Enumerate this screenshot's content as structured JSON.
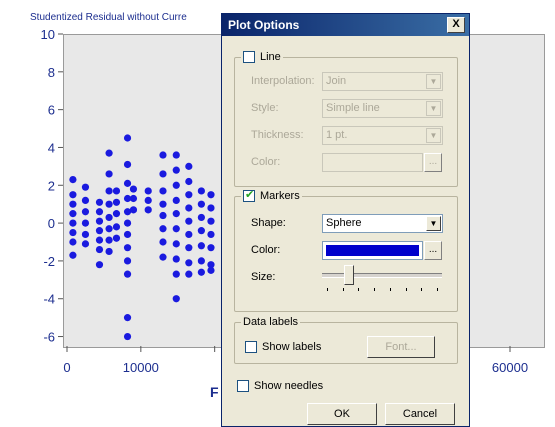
{
  "plot": {
    "title": "Studentized Residual without Curre",
    "x_axis_letter": "F",
    "y_ticks": [
      "10",
      "8",
      "6",
      "4",
      "2",
      "0",
      "-2",
      "-4",
      "-6"
    ],
    "x_ticks": [
      "0",
      "10000",
      "20",
      "60000"
    ],
    "point_color": "#1a1adf"
  },
  "chart_data": {
    "type": "scatter",
    "title": "Studentized Residual without Curre",
    "ylim": [
      -6.5,
      10
    ],
    "xlim": [
      -1000,
      62000
    ],
    "points": [
      [
        800,
        2.3
      ],
      [
        800,
        1.5
      ],
      [
        800,
        1
      ],
      [
        800,
        0.5
      ],
      [
        800,
        0
      ],
      [
        800,
        -0.5
      ],
      [
        800,
        -1
      ],
      [
        800,
        -1.7
      ],
      [
        2500,
        1.9
      ],
      [
        2500,
        1.2
      ],
      [
        2500,
        0.6
      ],
      [
        2500,
        0
      ],
      [
        2500,
        -0.6
      ],
      [
        2500,
        -1.1
      ],
      [
        4400,
        1.1
      ],
      [
        4400,
        0.6
      ],
      [
        4400,
        0.1
      ],
      [
        4400,
        -0.4
      ],
      [
        4400,
        -0.9
      ],
      [
        4400,
        -1.4
      ],
      [
        4400,
        -2.2
      ],
      [
        5700,
        3.7
      ],
      [
        5700,
        2.6
      ],
      [
        5700,
        1.7
      ],
      [
        5700,
        1
      ],
      [
        5700,
        0.3
      ],
      [
        5700,
        -0.3
      ],
      [
        5700,
        -0.9
      ],
      [
        5700,
        -1.5
      ],
      [
        6700,
        1.7
      ],
      [
        6700,
        1.1
      ],
      [
        6700,
        0.5
      ],
      [
        6700,
        -0.2
      ],
      [
        6700,
        -0.8
      ],
      [
        8200,
        4.5
      ],
      [
        8200,
        3.1
      ],
      [
        8200,
        2.1
      ],
      [
        8200,
        1.3
      ],
      [
        8200,
        0.6
      ],
      [
        8200,
        0
      ],
      [
        8200,
        -0.6
      ],
      [
        8200,
        -1.3
      ],
      [
        8200,
        -2
      ],
      [
        8200,
        -2.7
      ],
      [
        8200,
        -5
      ],
      [
        8200,
        -6
      ],
      [
        9000,
        1.8
      ],
      [
        9000,
        1.3
      ],
      [
        9000,
        0.7
      ],
      [
        11000,
        1.7
      ],
      [
        11000,
        1.2
      ],
      [
        11000,
        0.7
      ],
      [
        13000,
        3.6
      ],
      [
        13000,
        2.6
      ],
      [
        13000,
        1.7
      ],
      [
        13000,
        1
      ],
      [
        13000,
        0.4
      ],
      [
        13000,
        -0.3
      ],
      [
        13000,
        -1
      ],
      [
        13000,
        -1.8
      ],
      [
        14800,
        3.6
      ],
      [
        14800,
        2.8
      ],
      [
        14800,
        2
      ],
      [
        14800,
        1.2
      ],
      [
        14800,
        0.5
      ],
      [
        14800,
        -0.3
      ],
      [
        14800,
        -1.1
      ],
      [
        14800,
        -1.9
      ],
      [
        14800,
        -2.7
      ],
      [
        14800,
        -4
      ],
      [
        16500,
        3
      ],
      [
        16500,
        2.2
      ],
      [
        16500,
        1.5
      ],
      [
        16500,
        0.8
      ],
      [
        16500,
        0.1
      ],
      [
        16500,
        -0.6
      ],
      [
        16500,
        -1.3
      ],
      [
        16500,
        -2.1
      ],
      [
        16500,
        -2.7
      ],
      [
        18200,
        1.7
      ],
      [
        18200,
        1
      ],
      [
        18200,
        0.3
      ],
      [
        18200,
        -0.4
      ],
      [
        18200,
        -1.2
      ],
      [
        18200,
        -2
      ],
      [
        18200,
        -2.6
      ],
      [
        19500,
        1.5
      ],
      [
        19500,
        0.8
      ],
      [
        19500,
        0.1
      ],
      [
        19500,
        -0.6
      ],
      [
        19500,
        -1.3
      ],
      [
        19500,
        -2.2
      ],
      [
        19500,
        -2.5
      ],
      [
        50000,
        1.5
      ],
      [
        50000,
        0.8
      ],
      [
        50000,
        0.1
      ],
      [
        50000,
        -0.5
      ],
      [
        50000,
        -1.2
      ],
      [
        52000,
        1.3
      ],
      [
        52000,
        0.7
      ],
      [
        52000,
        0
      ],
      [
        52000,
        -0.6
      ],
      [
        52000,
        -1.3
      ],
      [
        52000,
        -2
      ],
      [
        52000,
        -2.7
      ],
      [
        53700,
        1.3
      ],
      [
        53700,
        0.5
      ],
      [
        53700,
        -0.2
      ]
    ]
  },
  "dialog": {
    "title": "Plot Options",
    "close_label": "X",
    "line_group": {
      "checkbox_label": "Line",
      "checked": false,
      "interpolation_label": "Interpolation:",
      "interpolation_value": "Join",
      "style_label": "Style:",
      "style_value": "Simple line",
      "thickness_label": "Thickness:",
      "thickness_value": "1 pt.",
      "color_label": "Color:",
      "color_button": "..."
    },
    "markers_group": {
      "checkbox_label": "Markers",
      "checked": true,
      "shape_label": "Shape:",
      "shape_value": "Sphere",
      "color_label": "Color:",
      "color_value": "#0000cc",
      "color_button": "...",
      "size_label": "Size:",
      "size_slider_position": 0.2,
      "size_ticks": 8
    },
    "data_labels_group": {
      "title": "Data labels",
      "show_labels_label": "Show labels",
      "show_labels_checked": false,
      "font_button": "Font..."
    },
    "show_needles_label": "Show needles",
    "show_needles_checked": false,
    "ok_label": "OK",
    "cancel_label": "Cancel"
  }
}
